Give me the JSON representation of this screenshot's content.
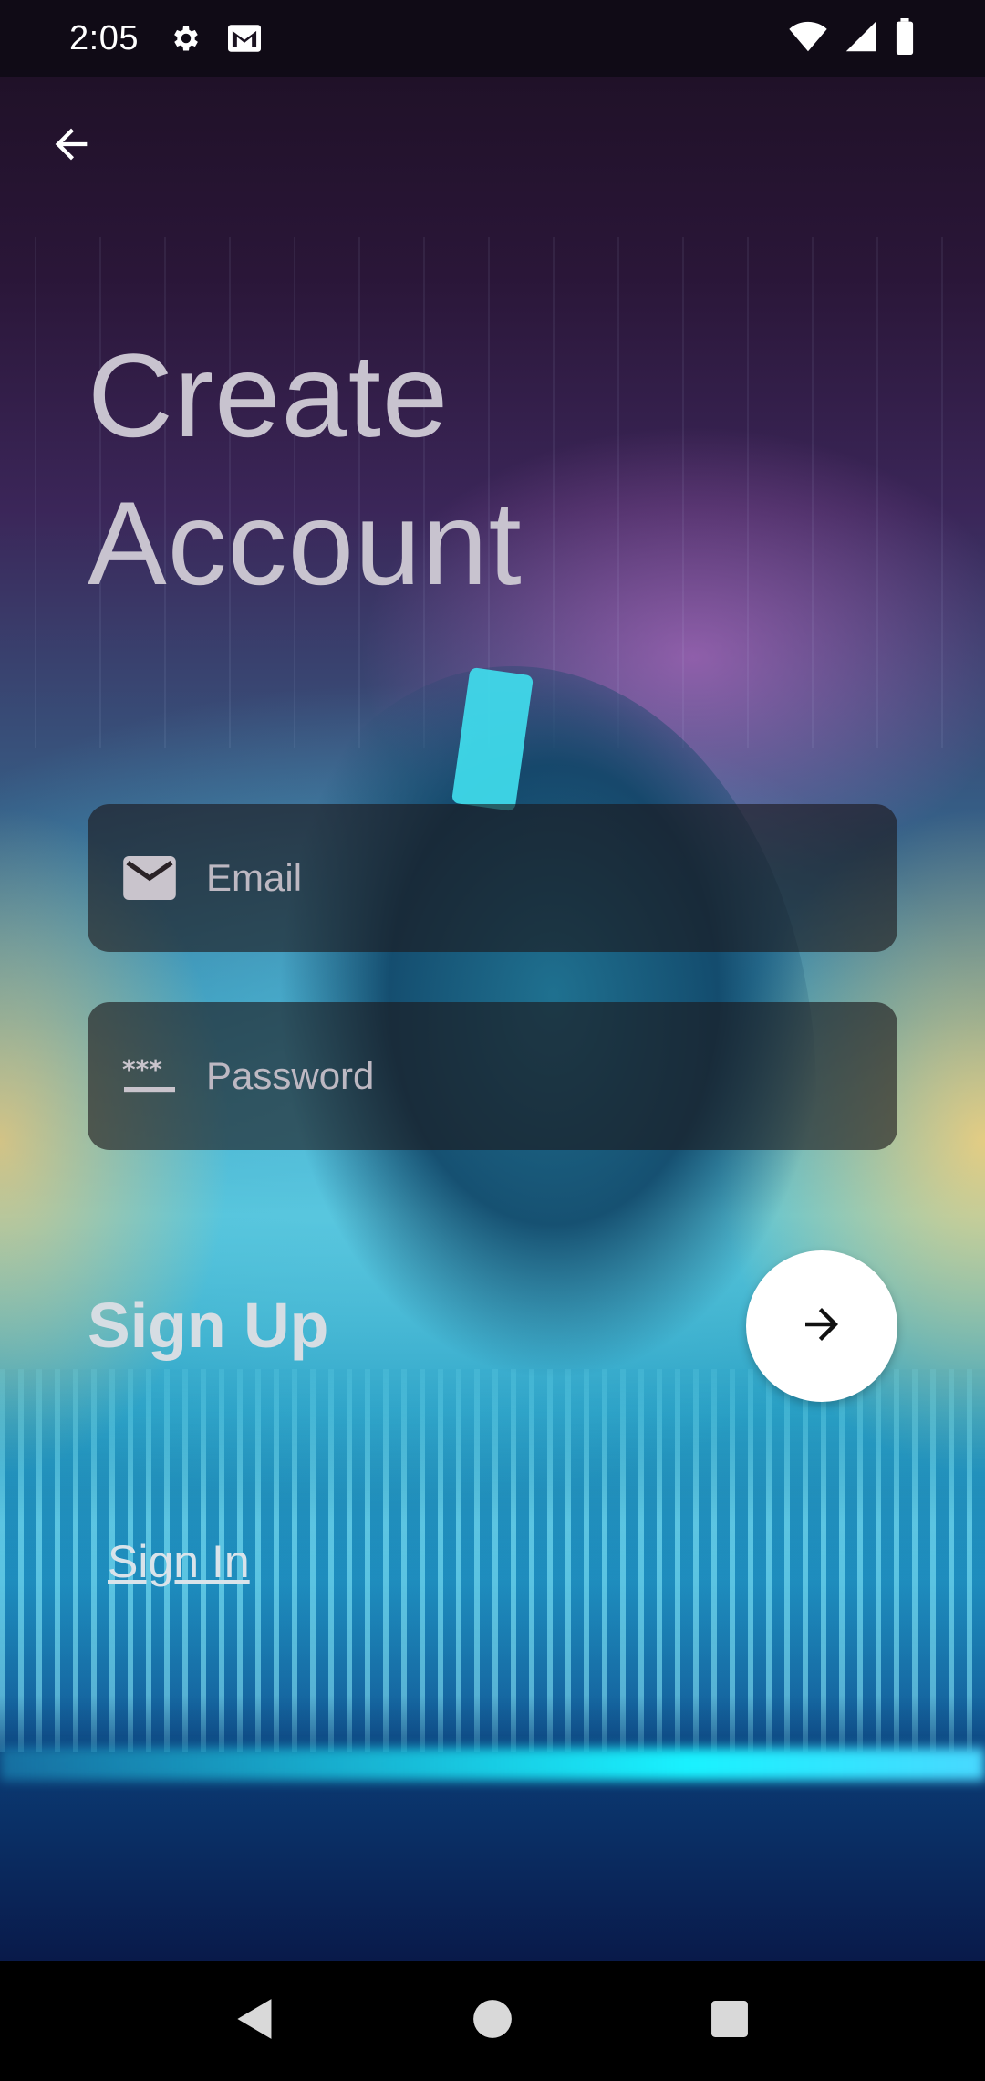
{
  "status_bar": {
    "time": "2:05",
    "left_icons": [
      "gear-icon",
      "mail-icon"
    ],
    "right_icons": [
      "wifi-icon",
      "signal-icon",
      "battery-icon"
    ]
  },
  "header": {
    "back_icon": "arrow-left-icon"
  },
  "title": {
    "line1": "Create",
    "line2": "Account"
  },
  "form": {
    "email": {
      "placeholder": "Email",
      "value": "",
      "icon": "envelope-icon"
    },
    "password": {
      "placeholder": "Password",
      "value": "",
      "icon": "password-icon"
    }
  },
  "signup": {
    "label": "Sign Up",
    "button_icon": "arrow-right-icon"
  },
  "signin": {
    "label": "Sign In"
  },
  "nav_bar": {
    "buttons": [
      "back-triangle-icon",
      "home-circle-icon",
      "recents-square-icon"
    ]
  },
  "colors": {
    "title_text": "#c8c3cf",
    "field_bg": "#1c161a",
    "button_bg": "#ffffff",
    "link_text": "#d9e3ea"
  }
}
